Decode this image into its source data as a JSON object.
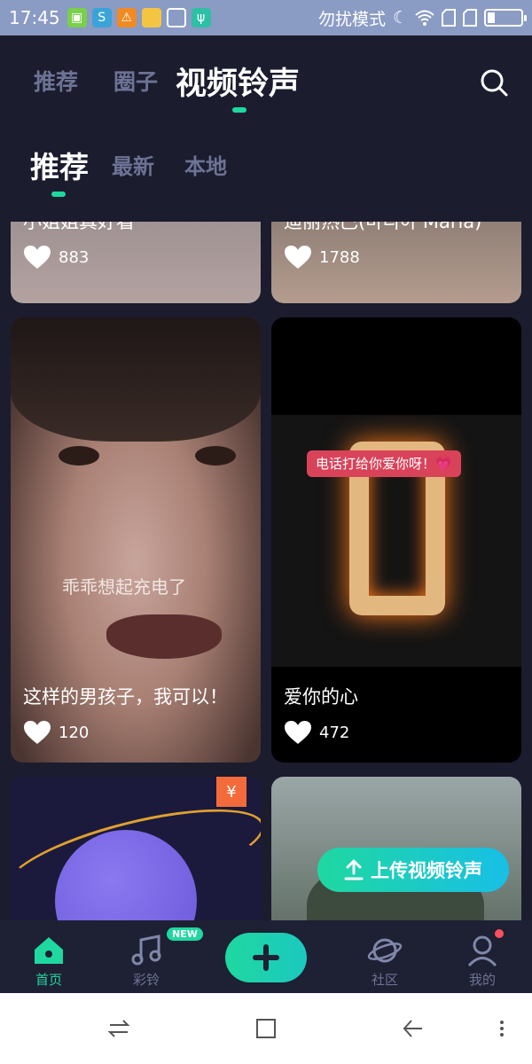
{
  "status_bar": {
    "time": "17:45",
    "dnd_text": "勿扰模式",
    "icons": [
      "notification-icon",
      "app-icon",
      "warning-icon",
      "folder-icon",
      "cleaner-icon",
      "usb-icon",
      "moon-icon",
      "wifi-icon",
      "sim-icon",
      "sim-icon",
      "battery-icon"
    ]
  },
  "top_tabs": {
    "items": [
      {
        "label": "推荐"
      },
      {
        "label": "圈子"
      },
      {
        "label": "视频铃声"
      }
    ],
    "active_index": 2
  },
  "sub_tabs": {
    "items": [
      {
        "label": "推荐"
      },
      {
        "label": "最新"
      },
      {
        "label": "本地"
      }
    ],
    "active_index": 0
  },
  "feed": {
    "cards": [
      {
        "title": "小姐姐真好看",
        "likes": "883"
      },
      {
        "title": "迪丽热巴(마리아  María)",
        "likes": "1788"
      },
      {
        "title": "这样的男孩子，我可以！",
        "likes": "120",
        "overlay_text": "乖乖想起充电了"
      },
      {
        "title": "爱你的心",
        "likes": "472",
        "overlay_text": "电话打给你爱你呀！💗"
      },
      {
        "title": "",
        "likes": "",
        "price_tag": "¥"
      },
      {
        "title": "",
        "likes": ""
      }
    ]
  },
  "upload_button": {
    "label": "上传视频铃声"
  },
  "bottom_nav": {
    "items": [
      {
        "label": "首页",
        "icon": "home-icon"
      },
      {
        "label": "彩铃",
        "icon": "music-icon",
        "badge": "NEW"
      },
      {
        "label": "",
        "icon": "plus-icon"
      },
      {
        "label": "社区",
        "icon": "planet-icon"
      },
      {
        "label": "我的",
        "icon": "profile-icon"
      }
    ],
    "active_index": 0
  },
  "colors": {
    "accent": "#1fd8a0",
    "background": "#1b1c2e",
    "inactive_text": "#6d7394",
    "status_bar": "#8a9bc4"
  }
}
